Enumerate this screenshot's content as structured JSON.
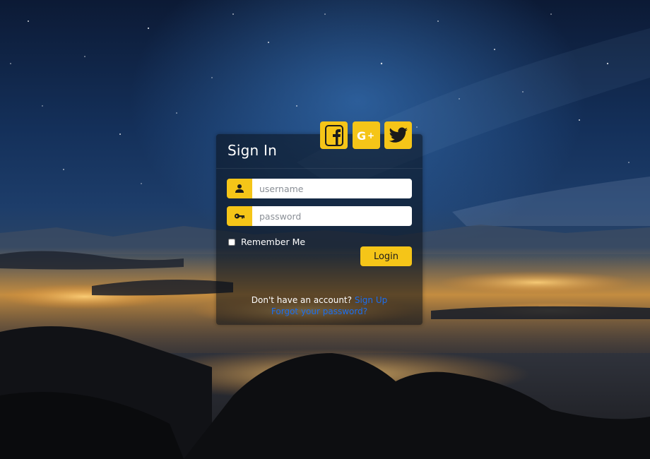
{
  "login": {
    "title": "Sign In",
    "username_placeholder": "username",
    "password_placeholder": "password",
    "remember_label": "Remember Me",
    "login_button": "Login",
    "no_account_text": "Don't have an account?",
    "signup_link": "Sign Up",
    "forgot_link": "Forgot your password?"
  },
  "social": [
    {
      "name": "facebook",
      "icon": "facebook-icon"
    },
    {
      "name": "google-plus",
      "icon": "google-plus-icon"
    },
    {
      "name": "twitter",
      "icon": "twitter-icon"
    }
  ],
  "colors": {
    "accent": "#f5c518",
    "link": "#1b6ef0",
    "card_bg": "rgba(10,14,22,0.55)"
  }
}
